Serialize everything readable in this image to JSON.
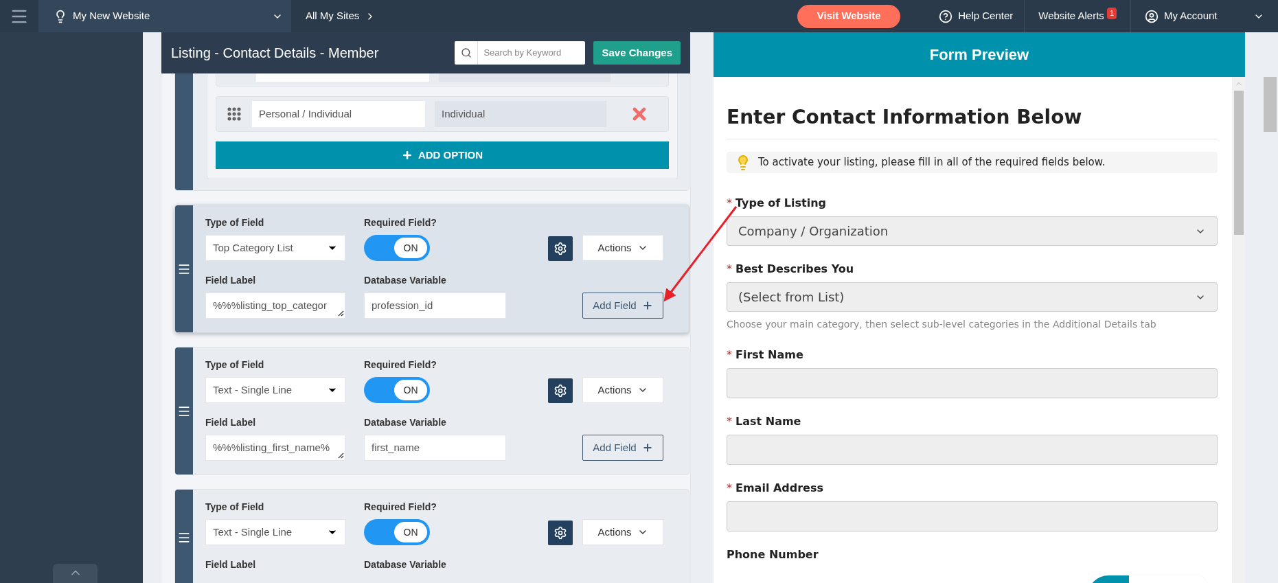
{
  "topbar": {
    "site": "My New Website",
    "all_sites": "All My Sites",
    "visit": "Visit Website",
    "help": "Help Center",
    "alerts": {
      "label": "Website Alerts",
      "count": "1"
    },
    "account": "My Account"
  },
  "editor": {
    "title": "Listing - Contact Details - Member",
    "search": {
      "placeholder": "Search by Keyword"
    },
    "save": "Save Changes",
    "options": [
      {
        "label": "Personal / Individual",
        "value": "Individual"
      }
    ],
    "add_option": "ADD OPTION",
    "fields": [
      {
        "highlighted": true,
        "type_label": "Type of Field",
        "type": "Top Category List",
        "required_label": "Required Field?",
        "required": {
          "on": true,
          "text": "ON"
        },
        "actions": "Actions",
        "field_label_label": "Field Label",
        "field_label": "%%%listing_top_categor",
        "db_label": "Database Variable",
        "db": "profession_id",
        "add": "Add Field"
      },
      {
        "highlighted": false,
        "type_label": "Type of Field",
        "type": "Text - Single Line",
        "required_label": "Required Field?",
        "required": {
          "on": true,
          "text": "ON"
        },
        "actions": "Actions",
        "field_label_label": "Field Label",
        "field_label": "%%%listing_first_name%",
        "db_label": "Database Variable",
        "db": "first_name",
        "add": "Add Field"
      },
      {
        "highlighted": false,
        "type_label": "Type of Field",
        "type": "Text - Single Line",
        "required_label": "Required Field?",
        "required": {
          "on": true,
          "text": "ON"
        },
        "actions": "Actions",
        "field_label_label": "Field Label",
        "db_label": "Database Variable"
      }
    ]
  },
  "preview": {
    "header": "Form Preview",
    "title": "Enter Contact Information Below",
    "notice": "To activate your listing, please fill in all of the required fields below.",
    "fields": [
      {
        "kind": "select",
        "mark": "*",
        "label": "Type of Listing",
        "value": "Company / Organization"
      },
      {
        "kind": "select",
        "mark": "*",
        "label": "Best Describes You",
        "value": "(Select from List)",
        "help": "Choose your main category, then select sub-level categories in the Additional Details tab"
      },
      {
        "kind": "text",
        "mark": "*",
        "label": "First Name"
      },
      {
        "kind": "text",
        "mark": "*",
        "label": "Last Name"
      },
      {
        "kind": "text",
        "mark": "*",
        "label": "Email Address"
      },
      {
        "kind": "label",
        "label": "Phone Number"
      }
    ]
  }
}
